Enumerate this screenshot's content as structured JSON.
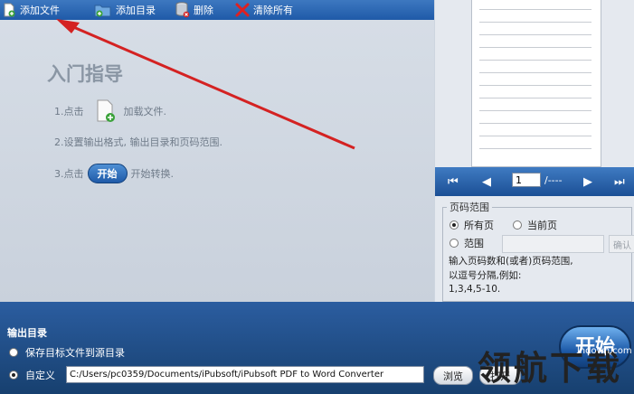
{
  "toolbar": {
    "add_file": "添加文件",
    "add_dir": "添加目录",
    "delete": "删除",
    "clear_all": "清除所有"
  },
  "guide": {
    "title": "入门指导",
    "step1_prefix": "1.点击",
    "step1_suffix": "加载文件.",
    "step2": "2.设置输出格式, 输出目录和页码范围.",
    "step3_prefix": "3.点击",
    "step3_button": "开始",
    "step3_suffix": "开始转换."
  },
  "nav": {
    "first": "⏮",
    "prev": "◀",
    "page_value": "1",
    "page_total": "/----",
    "next": "▶",
    "last": "⏭"
  },
  "range": {
    "legend": "页码范围",
    "all_pages": "所有页",
    "current_page": "当前页",
    "custom": "范围",
    "confirm": "确认",
    "hint_line1": "输入页码数和(或者)页码范围,",
    "hint_line2": "以逗号分隔,例如:",
    "hint_line3": "1,3,4,5-10."
  },
  "output": {
    "title": "输出目录",
    "save_to_source": "保存目标文件到源目录",
    "custom": "自定义",
    "path": "C:/Users/pc0359/Documents/iPubsoft/iPubsoft PDF to Word Converter",
    "browse": "浏览",
    "open": "打开",
    "start": "开始"
  },
  "watermark": {
    "text": "领航下载",
    "url": "lhdown.com"
  },
  "colors": {
    "toolbar_bg": "#1f5aa8",
    "arrow": "#d42222"
  }
}
